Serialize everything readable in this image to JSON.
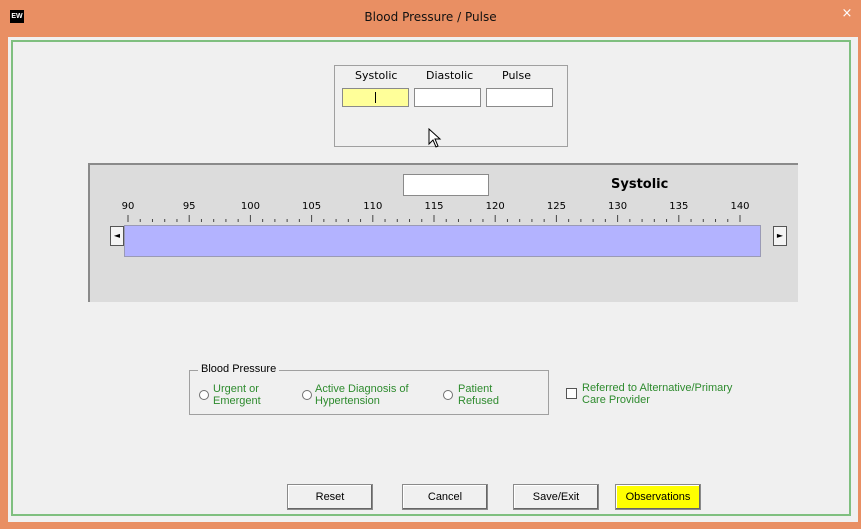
{
  "window": {
    "title": "Blood Pressure / Pulse",
    "logo_text": "EW",
    "close_glyph": "×"
  },
  "vitals": {
    "systolic_label": "Systolic",
    "diastolic_label": "Diastolic",
    "pulse_label": "Pulse",
    "systolic_value": "",
    "diastolic_value": "",
    "pulse_value": ""
  },
  "slider": {
    "title": "Systolic",
    "value_box": "",
    "min": 90,
    "max": 140,
    "tick_labels": [
      "90",
      "95",
      "100",
      "105",
      "110",
      "115",
      "120",
      "125",
      "130",
      "135",
      "140"
    ],
    "left_arrow": "◄",
    "right_arrow": "►",
    "fill_color": "#b3b3ff"
  },
  "blood_pressure": {
    "legend": "Blood Pressure",
    "options": [
      {
        "line1": "Urgent or",
        "line2": "Emergent"
      },
      {
        "line1": "Active Diagnosis of",
        "line2": "Hypertension"
      },
      {
        "line1": "Patient",
        "line2": "Refused"
      }
    ],
    "referred": {
      "line1": "Referred to Alternative/Primary",
      "line2": "Care Provider"
    }
  },
  "buttons": {
    "reset": "Reset",
    "cancel": "Cancel",
    "save_exit": "Save/Exit",
    "observations": "Observations"
  },
  "colors": {
    "title_bar": "#e98f63",
    "active_field": "#ffff99",
    "option_text": "#2e8b2e",
    "observations_button": "#ffff00"
  }
}
